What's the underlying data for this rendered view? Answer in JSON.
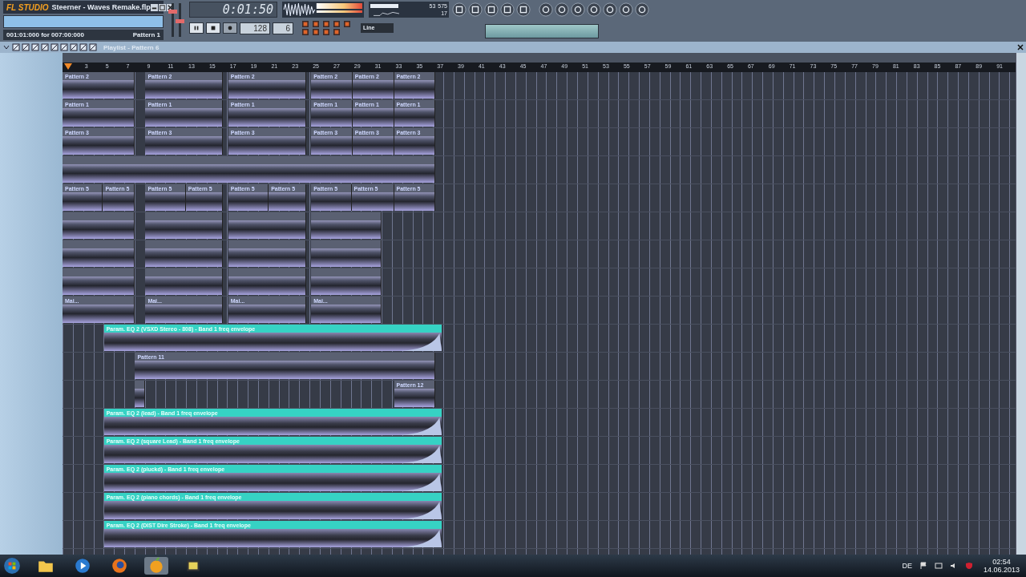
{
  "app": {
    "logo": "FL STUDIO",
    "title": "Steerner - Waves Remake.flp",
    "position": "001:01:000 for 007:00:000",
    "pattern": "Pattern 1"
  },
  "transport": {
    "time": "0:01:50",
    "tempo": "128",
    "pattern_number": "6",
    "snap": "Line"
  },
  "monitor": {
    "cpu": "53",
    "memory": "575",
    "polyphony": "17"
  },
  "playlist": {
    "title": "Playlist - Pattern 6",
    "ruler": [
      "3",
      "5",
      "7",
      "9",
      "11",
      "13",
      "15",
      "17",
      "19",
      "21",
      "23",
      "25",
      "27",
      "29",
      "31",
      "33",
      "35",
      "37",
      "39",
      "41",
      "43",
      "45",
      "47",
      "49",
      "51",
      "53",
      "55",
      "57",
      "59",
      "61",
      "63",
      "65",
      "67",
      "69",
      "71",
      "73",
      "75",
      "77",
      "79",
      "81",
      "83",
      "85",
      "87",
      "89",
      "91"
    ],
    "tracks": [
      {
        "clips": [
          {
            "kind": "pattern",
            "label": "Pattern 2"
          },
          {
            "kind": "pattern",
            "label": "Pattern 2"
          },
          {
            "kind": "pattern",
            "label": "Pattern 2"
          },
          {
            "kind": "pattern",
            "label": "Pattern 2"
          },
          {
            "kind": "pattern",
            "label": "Pattern 2"
          },
          {
            "kind": "pattern",
            "label": "Pattern 2"
          }
        ]
      },
      {
        "clips": [
          {
            "kind": "pattern",
            "label": "Pattern 1"
          },
          {
            "kind": "pattern",
            "label": "Pattern 1"
          },
          {
            "kind": "pattern",
            "label": "Pattern 1"
          },
          {
            "kind": "pattern",
            "label": "Pattern 1"
          },
          {
            "kind": "pattern",
            "label": "Pattern 1"
          },
          {
            "kind": "pattern",
            "label": "Pattern 1"
          }
        ]
      },
      {
        "clips": [
          {
            "kind": "pattern",
            "label": "Pattern 3"
          },
          {
            "kind": "pattern",
            "label": "Pattern 3"
          },
          {
            "kind": "pattern",
            "label": "Pattern 3"
          },
          {
            "kind": "pattern",
            "label": "Pattern 3"
          },
          {
            "kind": "pattern",
            "label": "Pattern 3"
          },
          {
            "kind": "pattern",
            "label": "Pattern 3"
          }
        ]
      },
      {
        "clips": [
          {
            "kind": "pattern"
          }
        ]
      },
      {
        "clips": [
          {
            "kind": "pattern",
            "label": "Pattern 5"
          },
          {
            "kind": "pattern",
            "label": "Pattern 5"
          },
          {
            "kind": "pattern",
            "label": "Pattern 5"
          },
          {
            "kind": "pattern",
            "label": "Pattern 5"
          },
          {
            "kind": "pattern",
            "label": "Pattern 5"
          },
          {
            "kind": "pattern",
            "label": "Pattern 5"
          },
          {
            "kind": "pattern",
            "label": "Pattern 5"
          },
          {
            "kind": "pattern",
            "label": "Pattern 5"
          },
          {
            "kind": "pattern",
            "label": "Pattern 5"
          }
        ]
      },
      {
        "clips": [
          {
            "kind": "pattern"
          },
          {
            "kind": "pattern"
          },
          {
            "kind": "pattern"
          },
          {
            "kind": "pattern"
          }
        ]
      },
      {
        "clips": [
          {
            "kind": "pattern"
          },
          {
            "kind": "pattern"
          },
          {
            "kind": "pattern"
          },
          {
            "kind": "pattern"
          }
        ]
      },
      {
        "clips": [
          {
            "kind": "pattern"
          },
          {
            "kind": "pattern"
          },
          {
            "kind": "pattern"
          },
          {
            "kind": "pattern"
          }
        ]
      },
      {
        "clips": [
          {
            "kind": "pattern",
            "label": "Mai..."
          },
          {
            "kind": "pattern",
            "label": "Mai..."
          },
          {
            "kind": "pattern",
            "label": "Mai..."
          },
          {
            "kind": "pattern",
            "label": "Mai..."
          }
        ]
      },
      {
        "clips": [
          {
            "kind": "automation",
            "label": "Param. EQ 2 (VSXD Stereo - 808) - Band 1 freq envelope"
          }
        ]
      },
      {
        "clips": [
          {
            "kind": "pattern",
            "label": "Pattern 11"
          }
        ]
      },
      {
        "clips": [
          {
            "kind": "pattern"
          },
          {
            "kind": "pattern",
            "label": "Pattern 12"
          }
        ]
      },
      {
        "clips": [
          {
            "kind": "automation",
            "label": "Param. EQ 2 (lead) - Band 1 freq envelope"
          }
        ]
      },
      {
        "clips": [
          {
            "kind": "automation",
            "label": "Param. EQ 2 (square Lead) - Band 1 freq envelope"
          }
        ]
      },
      {
        "clips": [
          {
            "kind": "automation",
            "label": "Param. EQ 2 (pluckd) - Band 1 freq envelope"
          }
        ]
      },
      {
        "clips": [
          {
            "kind": "automation",
            "label": "Param. EQ 2 (piano chords) - Band 1 freq envelope"
          }
        ]
      },
      {
        "clips": [
          {
            "kind": "automation",
            "label": "Param. EQ 2 (DIST Dire Stroke) - Band 1 freq envelope"
          }
        ]
      }
    ]
  },
  "taskbar": {
    "language": "DE",
    "time": "02:54",
    "date": "14.06.2013"
  }
}
